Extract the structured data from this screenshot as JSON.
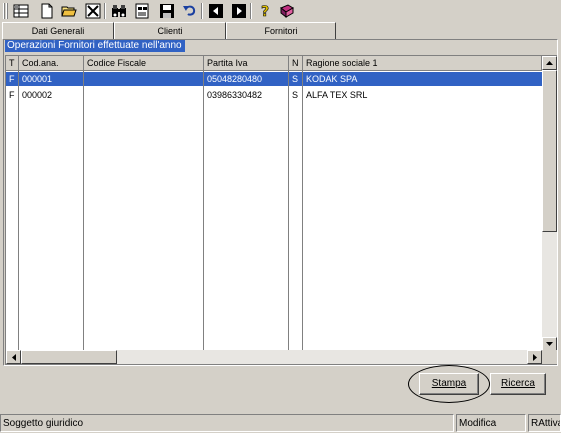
{
  "toolbar": {
    "buttons": [
      {
        "icon": "grid-icon"
      },
      {
        "icon": "new-document-icon"
      },
      {
        "icon": "open-folder-icon"
      },
      {
        "icon": "delete-icon"
      },
      {
        "icon": "binoculars-icon"
      },
      {
        "icon": "print-preview-icon"
      },
      {
        "icon": "save-icon"
      },
      {
        "icon": "undo-icon"
      },
      {
        "icon": "previous-icon"
      },
      {
        "icon": "next-icon"
      },
      {
        "icon": "help-icon"
      },
      {
        "icon": "exit-icon"
      }
    ]
  },
  "tabs": [
    {
      "label": "Dati Generali"
    },
    {
      "label": "Clienti"
    },
    {
      "label": "Fornitori"
    }
  ],
  "group": {
    "title": "Operazioni Fornitori effettuate nell'anno"
  },
  "grid": {
    "columns": [
      "T",
      "Cod.ana.",
      "Codice Fiscale",
      "Partita Iva",
      "N",
      "Ragione sociale 1"
    ],
    "rows": [
      {
        "t": "F",
        "cod": "000001",
        "cf": "",
        "piva": "05048280480",
        "n": "S",
        "ragione": "KODAK SPA",
        "selected": true
      },
      {
        "t": "F",
        "cod": "000002",
        "cf": "",
        "piva": "03986330482",
        "n": "S",
        "ragione": "ALFA TEX SRL",
        "selected": false
      }
    ]
  },
  "actions": {
    "stampa": "Stampa",
    "ricerca": "Ricerca"
  },
  "status": {
    "left": "Soggetto giuridico",
    "mode": "Modifica",
    "state": "RAttiva"
  },
  "colors": {
    "selection": "#3162c4",
    "face": "#d4d0c8"
  }
}
